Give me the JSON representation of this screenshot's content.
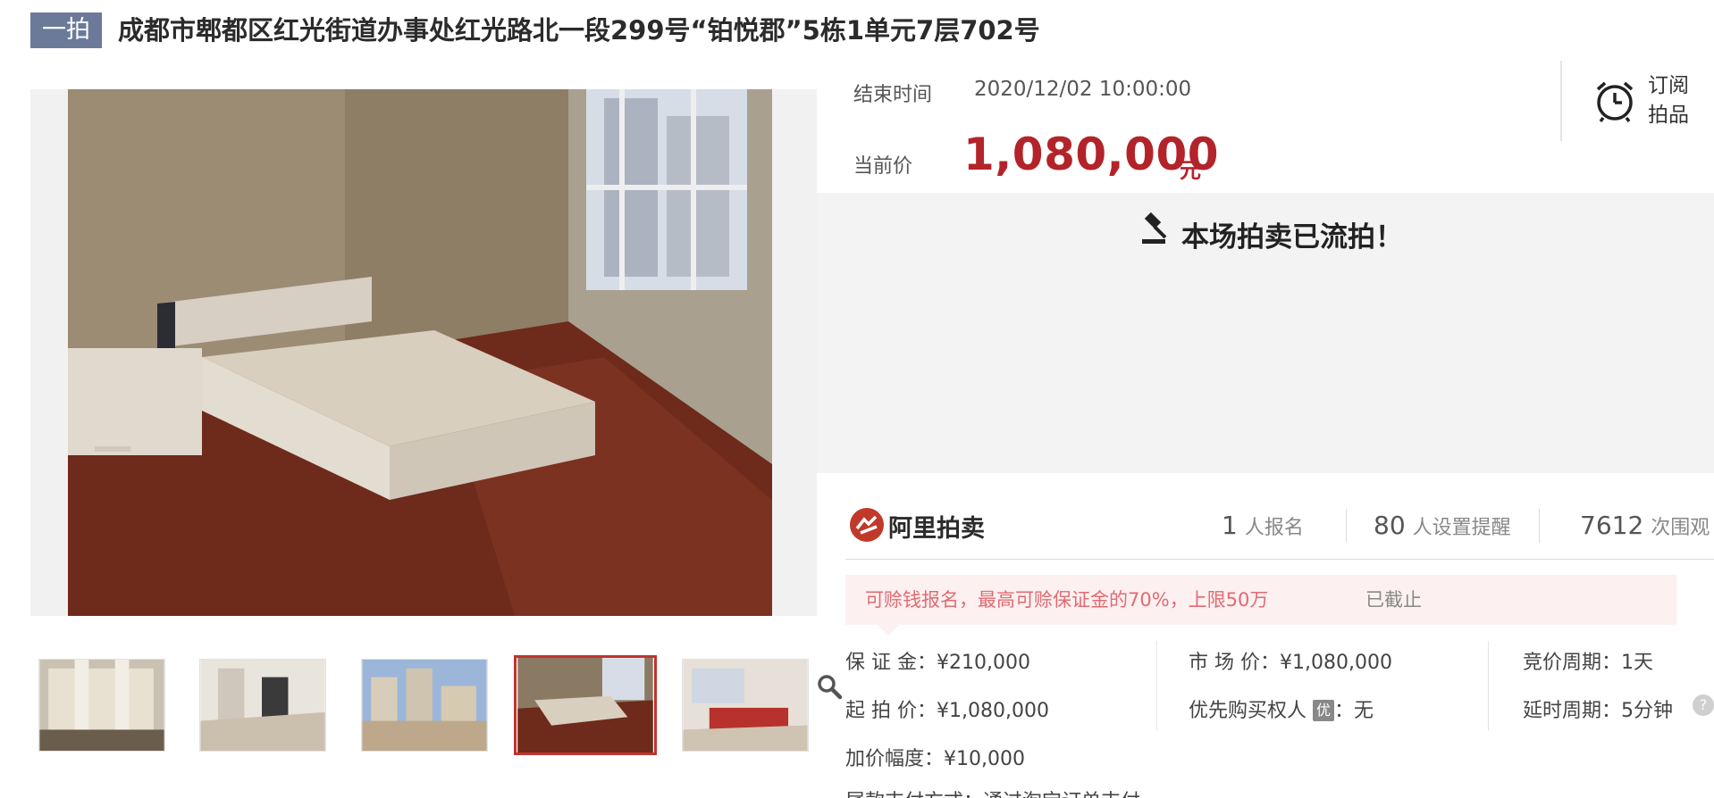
{
  "header": {
    "tag": "一拍",
    "title": "成都市郫都区红光街道办事处红光路北一段299号“铂悦郡”5栋1单元7层702号"
  },
  "auction": {
    "end_label": "结束时间",
    "end_time": "2020/12/02 10:00:00",
    "price_label": "当前价",
    "price": "1,080,000",
    "price_unit": "元",
    "subscribe_line1": "订阅",
    "subscribe_line2": "拍品",
    "status": "本场拍卖已流拍！"
  },
  "brand": {
    "name": "阿里拍卖"
  },
  "stats": [
    {
      "num": "1",
      "unit": "人报名"
    },
    {
      "num": "80",
      "unit": "人设置提醒"
    },
    {
      "num": "7612",
      "unit": "次围观"
    }
  ],
  "notice": {
    "text": "可赊钱报名，最高可赊保证金的70%，上限50万",
    "status": "已截止"
  },
  "details": {
    "deposit": "保 证 金：¥210,000",
    "start_price": "起 拍 价：¥1,080,000",
    "increment": "加价幅度：¥10,000",
    "market_price": "市 场 价：¥1,080,000",
    "priority_label": "优先购买权人",
    "priority_badge": "优",
    "priority_value": "：无",
    "cycle": "竞价周期：1天",
    "delay": "延时周期：5分钟",
    "help": "?",
    "payment_cut": "尾款支付方式：通过淘宝订单支付"
  },
  "gallery": {
    "thumbnails": [
      "building-exterior",
      "living-room-floor",
      "apartment-towers",
      "bedroom",
      "living-room-sofa"
    ],
    "active_index": 3
  },
  "colors": {
    "accent": "#b3232a",
    "tag_bg": "#6b7a99",
    "notice_bg": "#fdf0f0",
    "panel_bg": "#f3f3f3"
  }
}
